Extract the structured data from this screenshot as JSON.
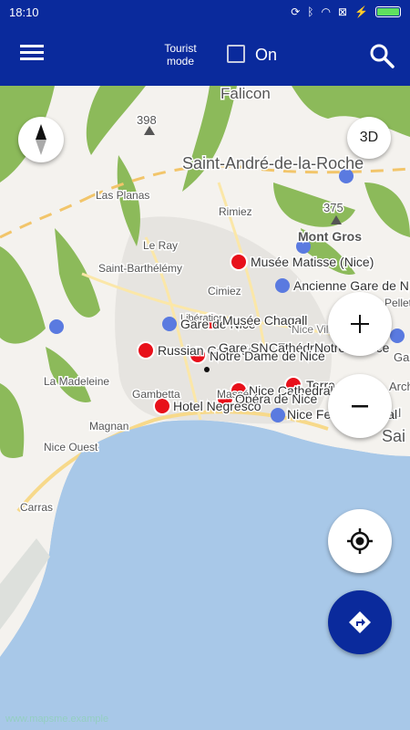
{
  "status_bar": {
    "time": "18:10"
  },
  "app_bar": {
    "menu_icon": "hamburger-menu-icon",
    "tourist_mode_label": "Tourist mode",
    "toggle_label": "On",
    "toggle_checked": false,
    "search_icon": "search-icon"
  },
  "colors": {
    "app_bar": "#0a2a9c",
    "poi_marker": "#e8101a",
    "transit_marker": "#5a7ae0",
    "water": "#a8c8e8",
    "land": "#f4f2ee",
    "forest": "#8cba5a"
  },
  "map": {
    "places": {
      "falicon": "Falicon",
      "st_andre": "Saint-André-de-la-Roche",
      "las_planas": "Las Planas",
      "rimiez": "Rimiez",
      "le_ray": "Le Ray",
      "st_barthelemy": "Saint-Barthélémy",
      "cimiez": "Cimiez",
      "mont_gros": "Mont Gros",
      "la_madeleine": "La Madeleine",
      "gambetta": "Gambetta",
      "magnan": "Magnan",
      "nice_ouest": "Nice Ouest",
      "carras": "Carras",
      "peak_398": "398",
      "peak_375": "375",
      "liberation": "Libération",
      "massena": "Masséna",
      "pellet": "Pellet",
      "gare_cut": "Gar",
      "saint_cut": "Sai",
      "archi_cut": "Arch",
      "al_cut": "al"
    },
    "pois": {
      "musee_matisse": "Musée Matisse (Nice)",
      "russian_cathedral": "Russian Cathedral",
      "notre_dame": "Notre Dame de Nice",
      "nice_cathedral": "Nice Cathedral",
      "opera": "Opéra de Nice",
      "hotel_negresco": "Hotel Negresco",
      "terra_amata": "Terra",
      "chagall": "Musée Chagall",
      "gare_sncf": "Gare SNCF",
      "cathedrale": "Cathédrale",
      "notre_france": "Notre-France"
    },
    "stations": {
      "ancienne_gare": "Ancienne Gare de N",
      "gare_de_nice": "Gare de Nice",
      "nice_ville": "Nice Ville",
      "nice_ferry": "Nice Ferry Terminal",
      "ferry_cut": "Nice Fe"
    }
  },
  "controls": {
    "compass_icon": "compass-icon",
    "btn_3d": "3D",
    "zoom_in": "+",
    "zoom_out": "−",
    "locate_icon": "my-location-icon",
    "route_icon": "directions-icon"
  },
  "watermark": "www.mapsme.example"
}
